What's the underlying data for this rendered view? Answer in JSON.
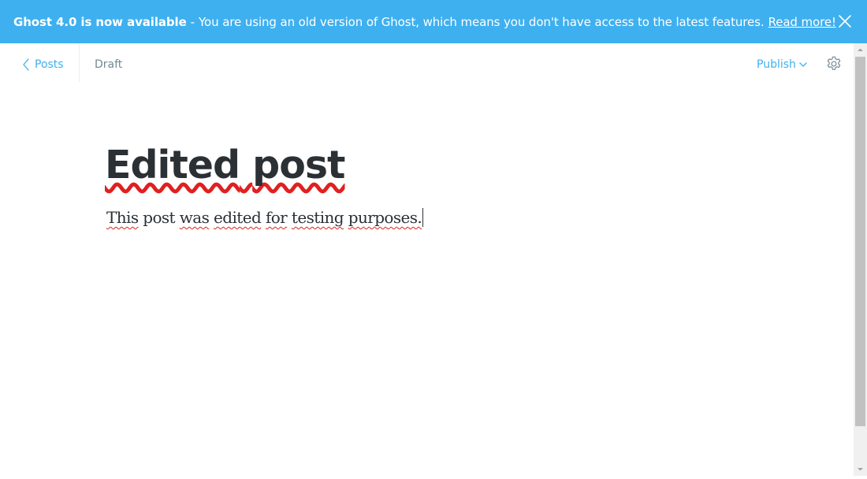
{
  "banner": {
    "headline": "Ghost 4.0 is now available",
    "separator": "-",
    "message": "You are using an old version of Ghost, which means you don't have access to the latest features.",
    "link": "Read more!",
    "close_icon": "close-icon"
  },
  "header": {
    "back_label": "Posts",
    "status": "Draft",
    "publish_label": "Publish",
    "settings_icon": "gear-icon"
  },
  "post": {
    "title_word1": "Edited",
    "title_word2": "post",
    "body_words": [
      "This",
      "post",
      "was",
      "edited",
      "for",
      "testing",
      "purposes."
    ]
  },
  "colors": {
    "accent": "#3eb0ef",
    "text": "#2b3035",
    "muted": "#738a94",
    "spellcheck": "#e02020"
  }
}
